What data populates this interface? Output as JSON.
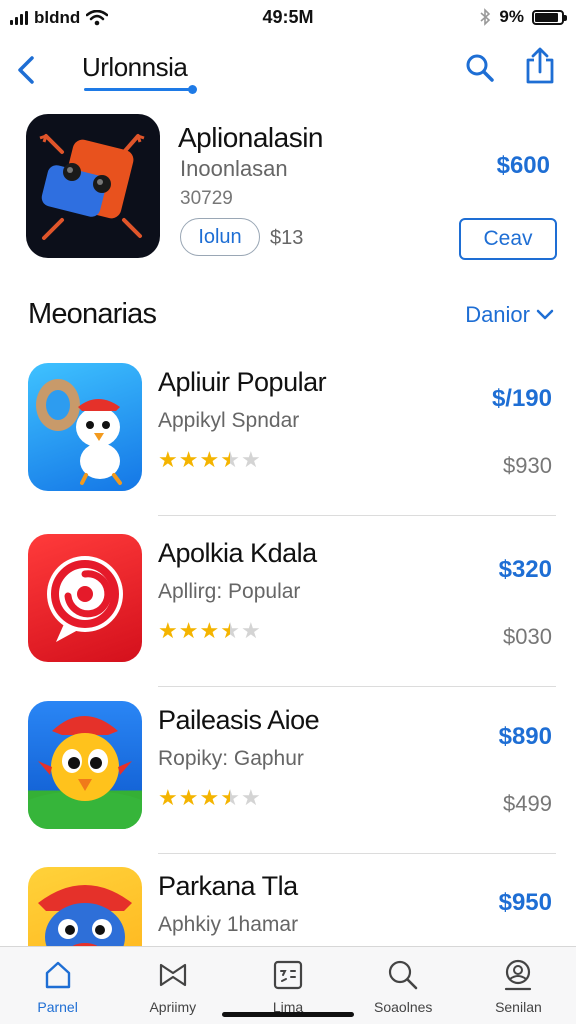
{
  "status_bar": {
    "carrier": "bldnd",
    "time": "49:5M",
    "battery_text": "9%",
    "battery_level": 0.9,
    "icons": [
      "signal-icon",
      "wifi-icon",
      "bluetooth-icon",
      "battery-icon"
    ]
  },
  "nav": {
    "title": "Urlonnsia",
    "accent": "#1e7ae6",
    "icons": [
      "back-chevron-icon",
      "search-icon",
      "share-icon"
    ]
  },
  "featured": {
    "name": "Aplionalasin",
    "subtitle": "Inoonlasan",
    "number": "30729",
    "install_label": "Iolun",
    "small_price": "$13",
    "price": "$600",
    "get_label": "Ceav"
  },
  "section": {
    "title": "Meonarias",
    "filter_label": "Danior",
    "filter_icon": "chevron-down-icon"
  },
  "apps": [
    {
      "name": "Apliuir Popular",
      "subtitle": "Appikyl Spndar",
      "rating": 3.5,
      "price": "$/190",
      "price2": "$930",
      "icon": "bird-character-icon"
    },
    {
      "name": "Apolkia Kdala",
      "subtitle": "Apllirg: Popular",
      "rating": 3.5,
      "price": "$320",
      "price2": "$030",
      "icon": "red-swirl-icon"
    },
    {
      "name": "Paileasis Aioe",
      "subtitle": "Ropiky: Gaphur",
      "rating": 3.5,
      "price": "$890",
      "price2": "$499",
      "icon": "yellow-bird-icon"
    },
    {
      "name": "Parkana Tla",
      "subtitle": "Aphkiy 1hamar",
      "rating": 0,
      "price": "$950",
      "price2": "",
      "icon": "pirate-character-icon"
    }
  ],
  "tabs": [
    {
      "label": "Parnel",
      "icon": "home-icon",
      "active": true
    },
    {
      "label": "Apriimy",
      "icon": "bowtie-icon",
      "active": false
    },
    {
      "label": "Lima",
      "icon": "calendar-icon",
      "active": false
    },
    {
      "label": "Soaolnes",
      "icon": "search-icon",
      "active": false
    },
    {
      "label": "Senilan",
      "icon": "profile-icon",
      "active": false
    }
  ]
}
